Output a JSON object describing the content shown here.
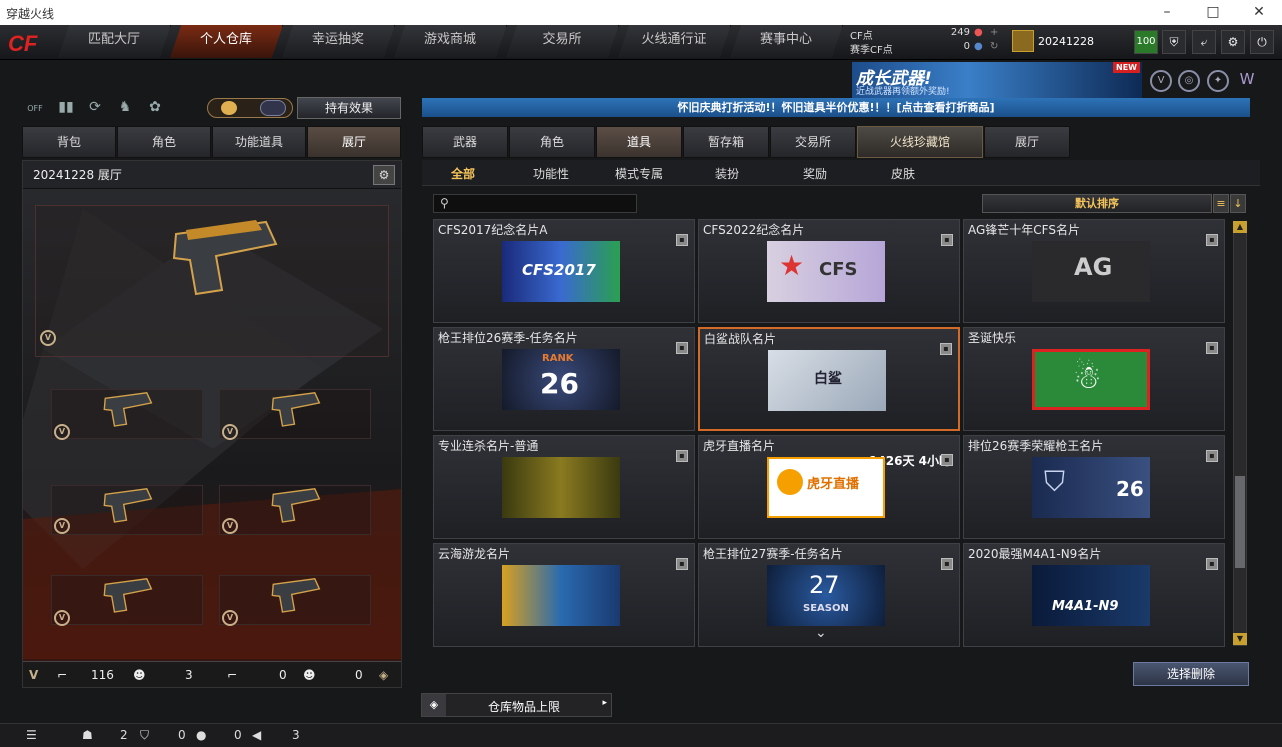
{
  "window": {
    "title": "穿越火线"
  },
  "nav": {
    "tabs": [
      "匹配大厅",
      "个人仓库",
      "幸运抽奖",
      "游戏商城",
      "交易所",
      "火线通行证",
      "赛事中心"
    ],
    "active": 1
  },
  "cf": {
    "cf_label": "CF点",
    "cf_value": "249",
    "season_label": "赛季CF点",
    "season_value": "0"
  },
  "user": {
    "name": "20241228",
    "level": "100"
  },
  "banner": {
    "title": "成长武器!",
    "sub": "近战武器再领额外奖励!",
    "new": "NEW"
  },
  "left": {
    "toggle_off": "OFF",
    "effect_button": "持有效果",
    "tabs": [
      "背包",
      "角色",
      "功能道具",
      "展厅"
    ],
    "active_tab": 3,
    "header": "20241228 展厅",
    "footer": {
      "weapon_count": "116",
      "char_count": "3",
      "weapon2_count": "0",
      "char2_count": "0"
    }
  },
  "notice": "怀旧庆典打折活动!！怀旧道具半价优惠!！！[点击查看打折商品]",
  "right": {
    "tabs": [
      "武器",
      "角色",
      "道具",
      "暂存箱",
      "交易所",
      "火线珍藏馆",
      "展厅"
    ],
    "active_tab": 2,
    "subtabs": [
      "全部",
      "功能性",
      "模式专属",
      "装扮",
      "奖励",
      "皮肤"
    ],
    "active_subtab": 0,
    "sort_label": "默认排序",
    "cards": [
      {
        "name": "CFS2017纪念名片A",
        "thumb": "CFS2017"
      },
      {
        "name": "CFS2022纪念名片",
        "thumb": "CFS"
      },
      {
        "name": "AG锋芒十年CFS名片",
        "thumb": "AG"
      },
      {
        "name": "枪王排位26赛季-任务名片",
        "thumb": "26"
      },
      {
        "name": "白鲨战队名片",
        "thumb": "白鲨"
      },
      {
        "name": "圣诞快乐",
        "thumb": "☃"
      },
      {
        "name": "专业连杀名片-普通",
        "thumb": ""
      },
      {
        "name": "虎牙直播名片",
        "thumb": "虎牙直播",
        "expire": "1426天 4小时"
      },
      {
        "name": "排位26赛季荣耀枪王名片",
        "thumb": "26"
      },
      {
        "name": "云海游龙名片",
        "thumb": ""
      },
      {
        "name": "枪王排位27赛季-任务名片",
        "thumb": "27"
      },
      {
        "name": "2020最强M4A1-N9名片",
        "thumb": "M4A1-N9"
      }
    ],
    "delete_button": "选择删除",
    "capacity_button": "仓库物品上限"
  },
  "status": {
    "friends": "2",
    "guild": "0",
    "chat": "0",
    "sound": "3"
  }
}
